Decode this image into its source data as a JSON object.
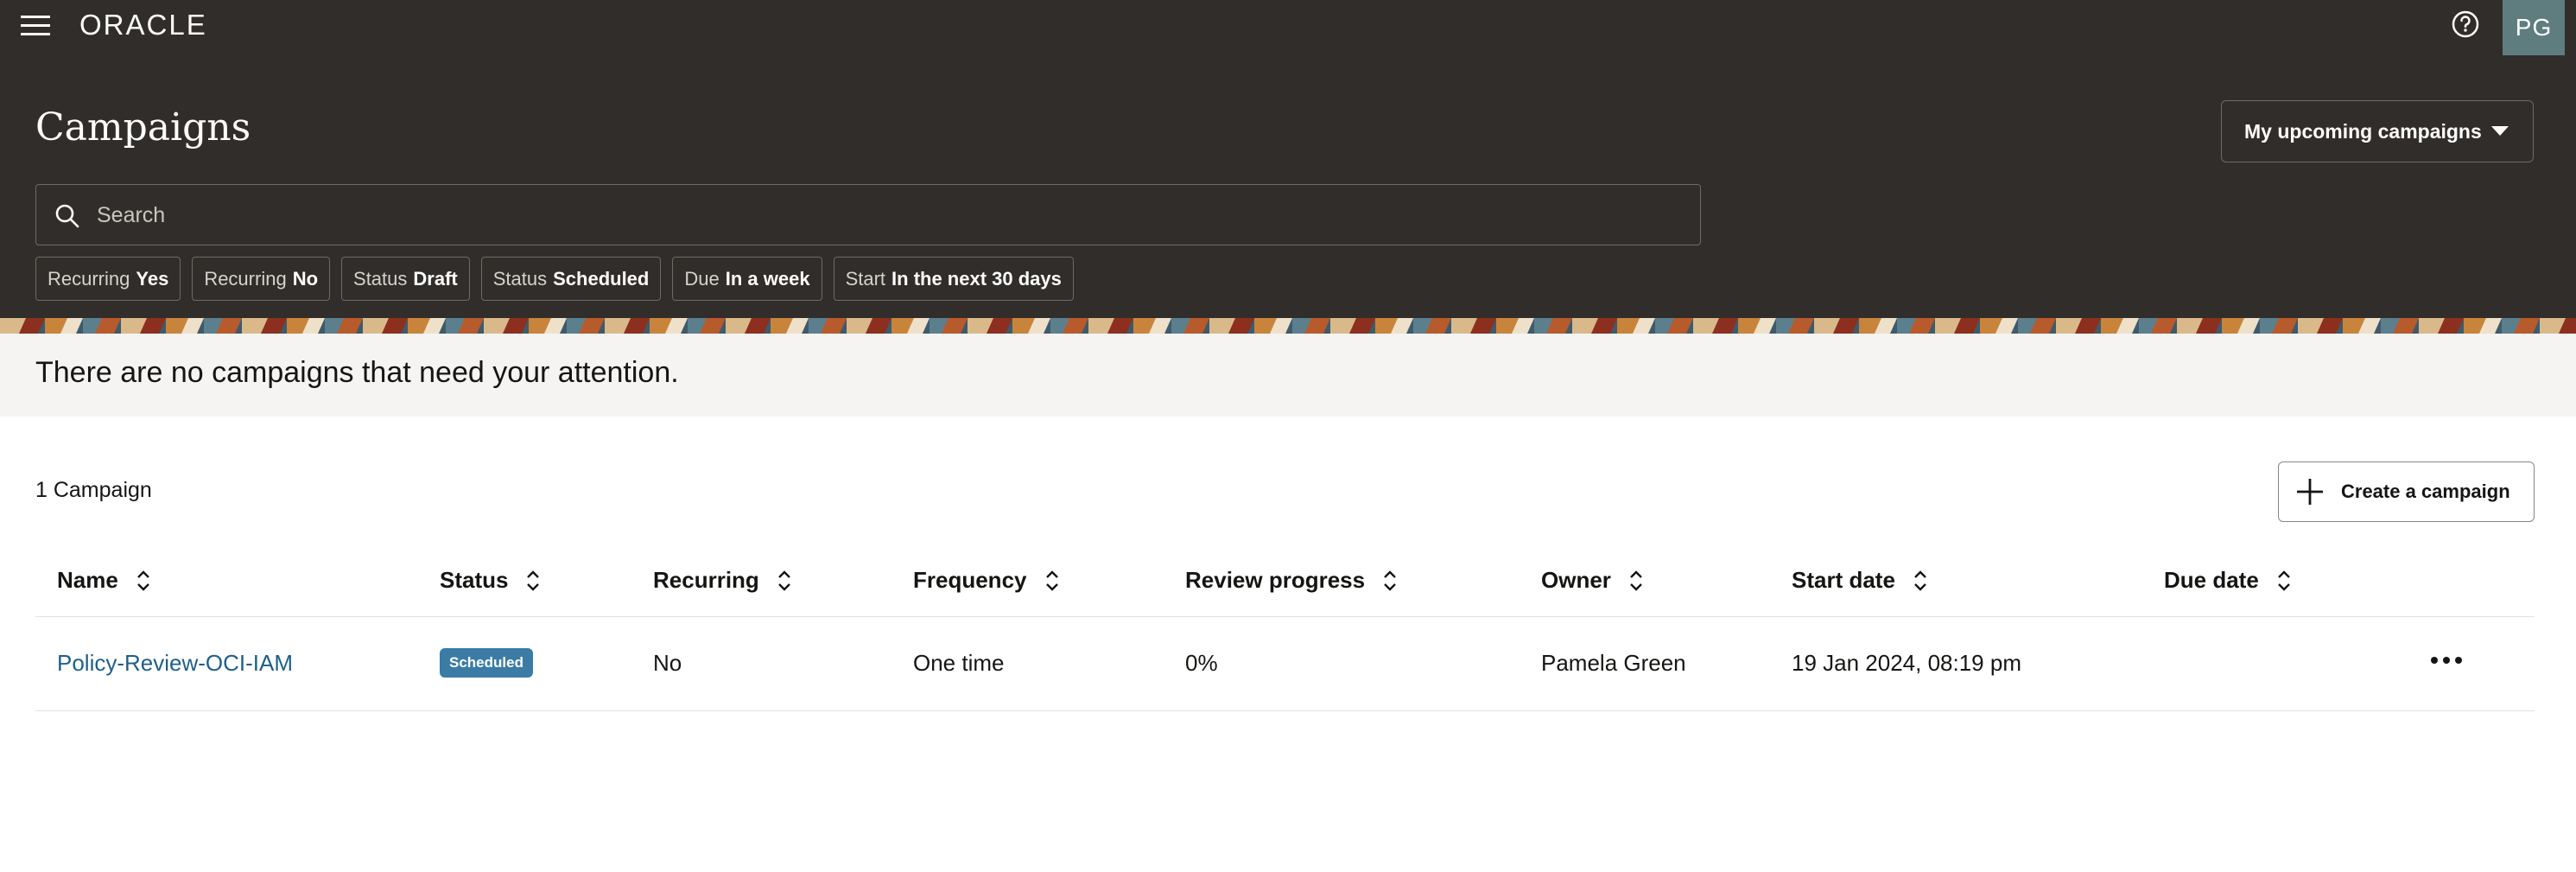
{
  "header": {
    "logo_text": "ORACLE",
    "avatar_initials": "PG",
    "page_title": "Campaigns",
    "view_select": "My upcoming campaigns"
  },
  "search": {
    "placeholder": "Search",
    "value": ""
  },
  "filters": [
    {
      "key": "Recurring",
      "value": "Yes"
    },
    {
      "key": "Recurring",
      "value": "No"
    },
    {
      "key": "Status",
      "value": "Draft"
    },
    {
      "key": "Status",
      "value": "Scheduled"
    },
    {
      "key": "Due",
      "value": "In a week"
    },
    {
      "key": "Start",
      "value": "In the next 30 days"
    }
  ],
  "attention": {
    "message": "There are no campaigns that need your attention."
  },
  "toolbar": {
    "count_label": "1 Campaign",
    "create_label": "Create a campaign"
  },
  "table": {
    "columns": [
      "Name",
      "Status",
      "Recurring",
      "Frequency",
      "Review progress",
      "Owner",
      "Start date",
      "Due date"
    ],
    "rows": [
      {
        "name": "Policy-Review-OCI-IAM",
        "status": "Scheduled",
        "recurring": "No",
        "frequency": "One time",
        "review_progress": "0%",
        "owner": "Pamela Green",
        "start_date": "19 Jan 2024, 08:19 pm",
        "due_date": ""
      }
    ]
  },
  "colors": {
    "header_bg": "#312d2a",
    "banner_bg": "#f5f4f2",
    "link": "#1e5f8a",
    "status_scheduled": "#3a7ca5",
    "avatar_bg": "#5f7d7e"
  },
  "icons": {
    "menu": "hamburger-menu-icon",
    "help": "help-circle-icon",
    "search": "search-icon",
    "dropdown": "caret-down-icon",
    "sort": "sort-icon",
    "create": "plus-icon",
    "row_actions": "more-horizontal-icon"
  }
}
